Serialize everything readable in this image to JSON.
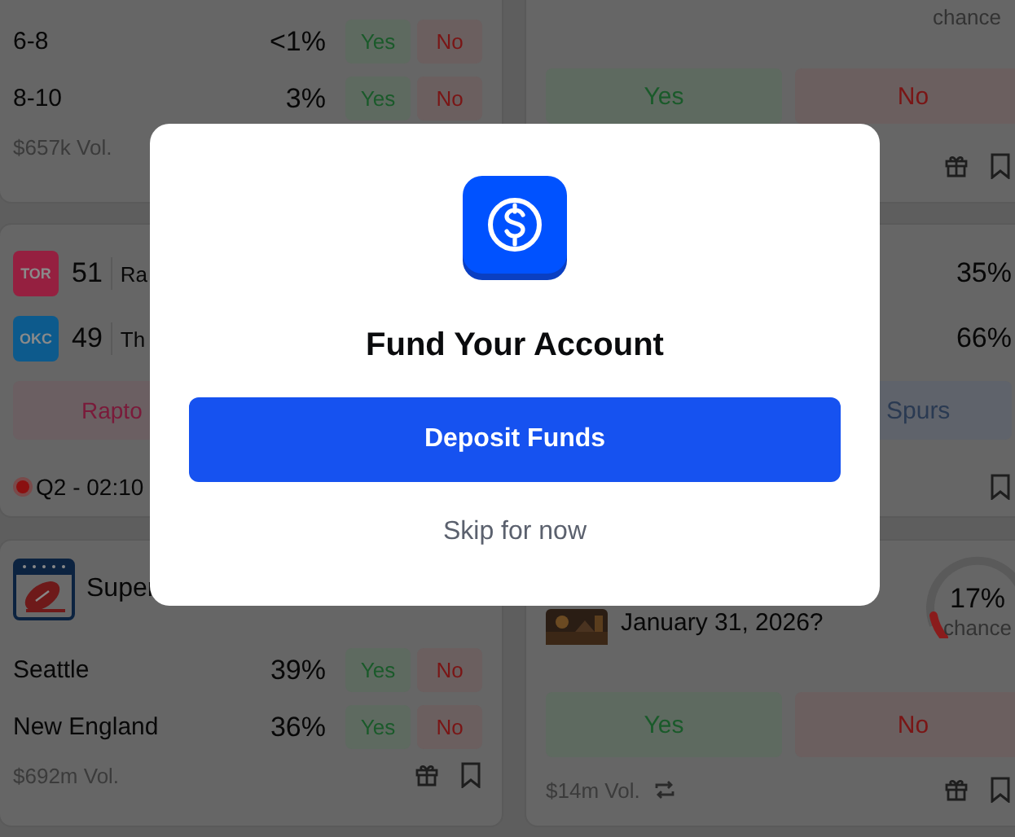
{
  "columns": [
    [
      {
        "kind": "outcomes",
        "outcomes": [
          {
            "label": "6-8",
            "chance": "<1%",
            "yes": "Yes",
            "no": "No"
          },
          {
            "label": "8-10",
            "chance": "3%",
            "yes": "Yes",
            "no": "No"
          }
        ],
        "footer": {
          "kind": "plain",
          "volume": "$657k Vol."
        }
      },
      {
        "kind": "game",
        "teams": [
          {
            "abbr": "TOR",
            "color": "#952040",
            "score": "51",
            "name": "Ra"
          },
          {
            "abbr": "OKC",
            "color": "#0d5a8c",
            "score": "49",
            "name": "Th"
          }
        ],
        "buttons": [
          {
            "label": "Rapto"
          }
        ],
        "footer": {
          "kind": "live",
          "status": "Q2 - 02:10"
        }
      },
      {
        "kind": "outcomes",
        "title": "Super",
        "outcomes": [
          {
            "label": "Seattle",
            "chance": "39%",
            "yes": "Yes",
            "no": "No"
          },
          {
            "label": "New England",
            "chance": "36%",
            "yes": "Yes",
            "no": "No"
          }
        ],
        "footer": {
          "kind": "market",
          "volume": "$692m Vol."
        }
      }
    ],
    [
      {
        "kind": "binary",
        "chance_label": "chance",
        "yes": "Yes",
        "no": "No",
        "footer": {
          "kind": "market"
        }
      },
      {
        "kind": "game",
        "teams": [
          {
            "chance": "35%"
          },
          {
            "chance": "66%"
          }
        ],
        "buttons": [
          {
            "label": "Spurs"
          }
        ],
        "footer": {
          "kind": "compact"
        }
      },
      {
        "kind": "binary",
        "picture": true,
        "title": "January 31, 2026?",
        "chance": "17%",
        "chance_label": "chance",
        "yes": "Yes",
        "no": "No",
        "footer": {
          "kind": "market",
          "volume": "$14m Vol.",
          "repeat": true
        }
      }
    ]
  ],
  "modal": {
    "title": "Fund Your Account",
    "primary": "Deposit Funds",
    "secondary": "Skip for now"
  }
}
